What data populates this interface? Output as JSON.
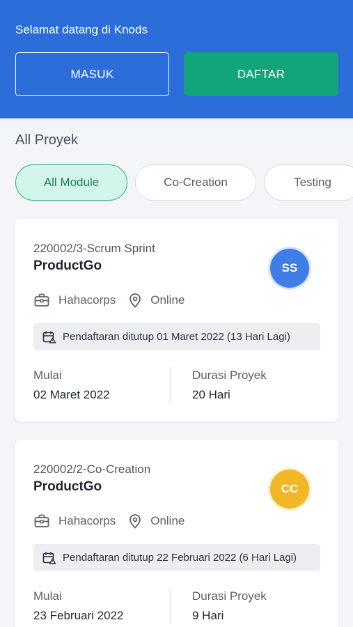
{
  "header": {
    "welcome": "Selamat datang di Knods",
    "login_label": "MASUK",
    "register_label": "DAFTAR",
    "bg_color": "#2c6ed9",
    "register_color": "#12a47a"
  },
  "section": {
    "title": "All Proyek"
  },
  "filters": [
    {
      "label": "All Module",
      "active": true
    },
    {
      "label": "Co-Creation",
      "active": false
    },
    {
      "label": "Testing",
      "active": false
    }
  ],
  "projects": [
    {
      "code": "220002/3-Scrum Sprint",
      "name": "ProductGo",
      "avatar": "SS",
      "avatar_color": "#3f7ee6",
      "company": "Hahacorps",
      "location": "Online",
      "notice": "Pendaftaran ditutup 01 Maret 2022 (13 Hari Lagi)",
      "start_label": "Mulai",
      "start_value": "02 Maret 2022",
      "duration_label": "Durasi Proyek",
      "duration_value": "20 Hari"
    },
    {
      "code": "220002/2-Co-Creation",
      "name": "ProductGo",
      "avatar": "CC",
      "avatar_color": "#f0b728",
      "company": "Hahacorps",
      "location": "Online",
      "notice": "Pendaftaran ditutup 22 Februari 2022 (6 Hari Lagi)",
      "start_label": "Mulai",
      "start_value": "23 Februari 2022",
      "duration_label": "Durasi Proyek",
      "duration_value": "9 Hari"
    }
  ],
  "icons": {
    "company": "briefcase-icon",
    "location": "map-pin-icon",
    "notice": "calendar-warning-icon"
  }
}
